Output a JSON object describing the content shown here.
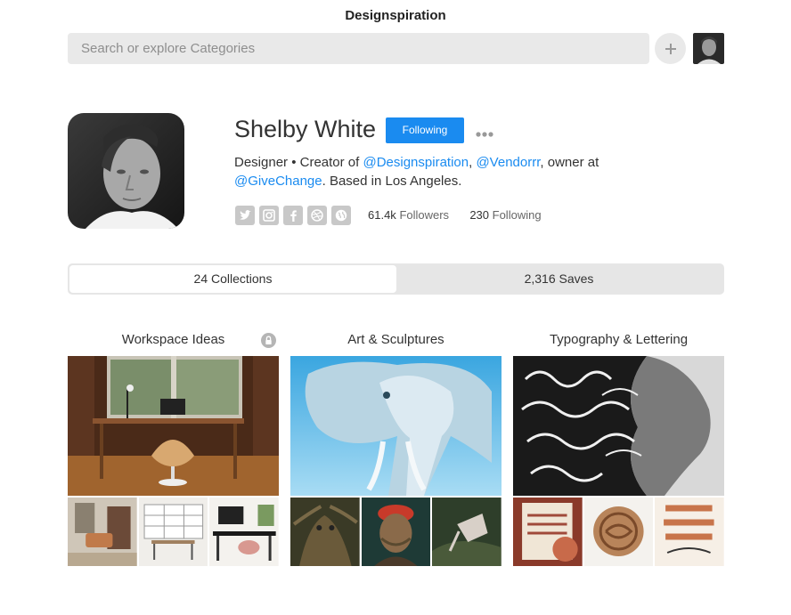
{
  "app": {
    "title": "Designspiration"
  },
  "search": {
    "placeholder": "Search or explore Categories",
    "value": ""
  },
  "header": {
    "add_icon": "plus-icon",
    "avatar": "user-avatar"
  },
  "profile": {
    "name": "Shelby White",
    "follow_label": "Following",
    "more_icon": "ellipsis-icon",
    "bio": {
      "part1": "Designer • Creator of ",
      "link1": "@Designspiration",
      "sep1": ", ",
      "link2": "@Vendorrr",
      "part2": ", owner at ",
      "link3": "@GiveChange",
      "part3": ". Based in Los Angeles."
    },
    "socials": [
      "twitter-icon",
      "instagram-icon",
      "facebook-icon",
      "dribbble-icon",
      "website-icon"
    ],
    "followers_count": "61.4k",
    "followers_label": "Followers",
    "following_count": "230",
    "following_label": "Following"
  },
  "tabs": [
    {
      "label": "24 Collections",
      "active": true
    },
    {
      "label": "2,316 Saves",
      "active": false
    }
  ],
  "collections": [
    {
      "title": "Workspace Ideas",
      "private": true
    },
    {
      "title": "Art & Sculptures",
      "private": false
    },
    {
      "title": "Typography & Lettering",
      "private": false
    }
  ],
  "colors": {
    "accent": "#1a8bf0",
    "search_bg": "#e9e9e9",
    "tab_bg": "#e6e6e6",
    "icon_gray": "#c8c8c8"
  }
}
